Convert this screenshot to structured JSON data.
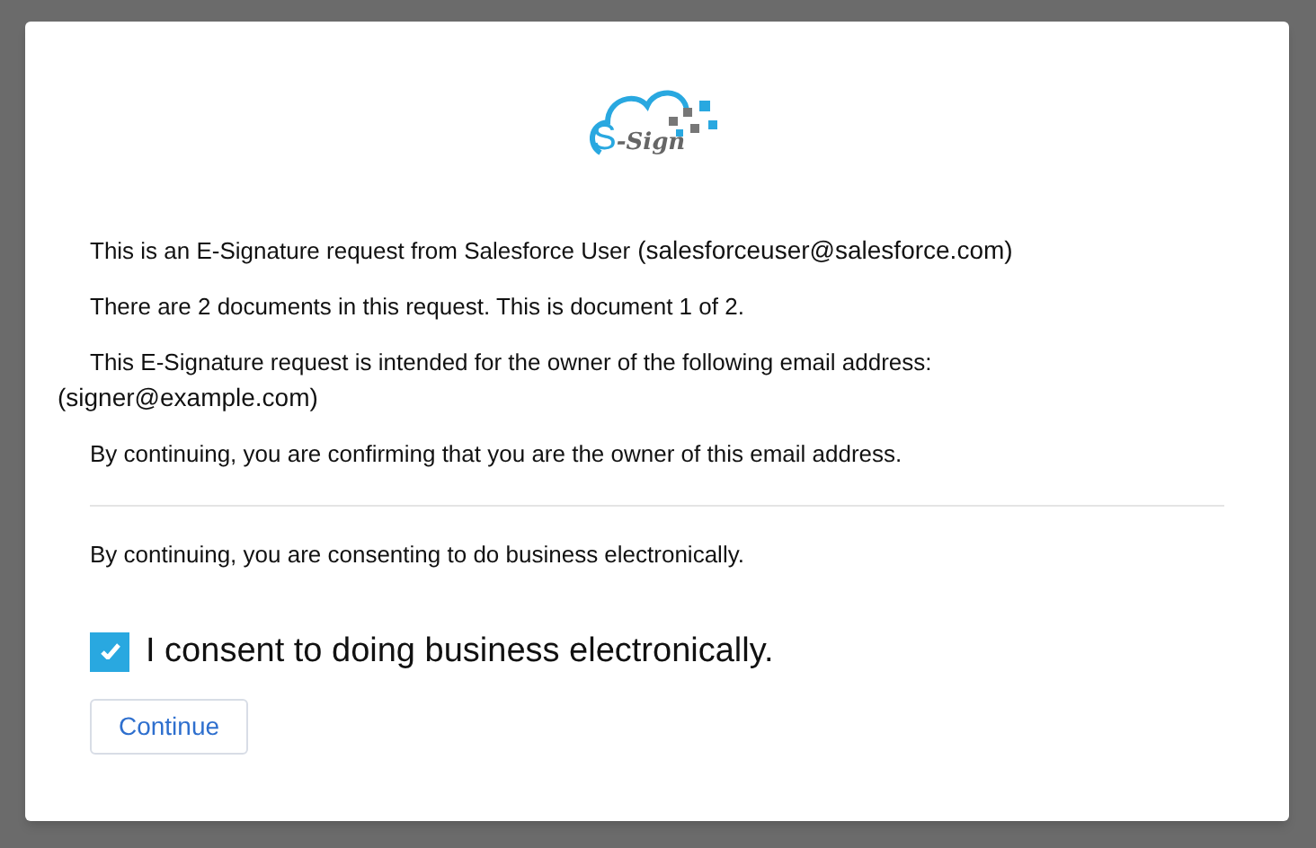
{
  "logo": {
    "initial": "S",
    "rest": "-Sign"
  },
  "messages": [
    {
      "text": "This is an E-Signature request from Salesforce User",
      "email": "(salesforceuser@salesforce.com)",
      "email_inline": true
    },
    {
      "text": "There are 2 documents in this request. This is document 1 of 2."
    },
    {
      "text": "This E-Signature request is intended for the owner of the following email address:",
      "email": "(signer@example.com)",
      "email_inline": false
    },
    {
      "text": "By continuing, you are confirming that you are the owner of this email address."
    }
  ],
  "consent_note": "By continuing, you are consenting to do business electronically.",
  "consent": {
    "label": "I consent to doing business electronically.",
    "checked": true
  },
  "continue_button": "Continue"
}
